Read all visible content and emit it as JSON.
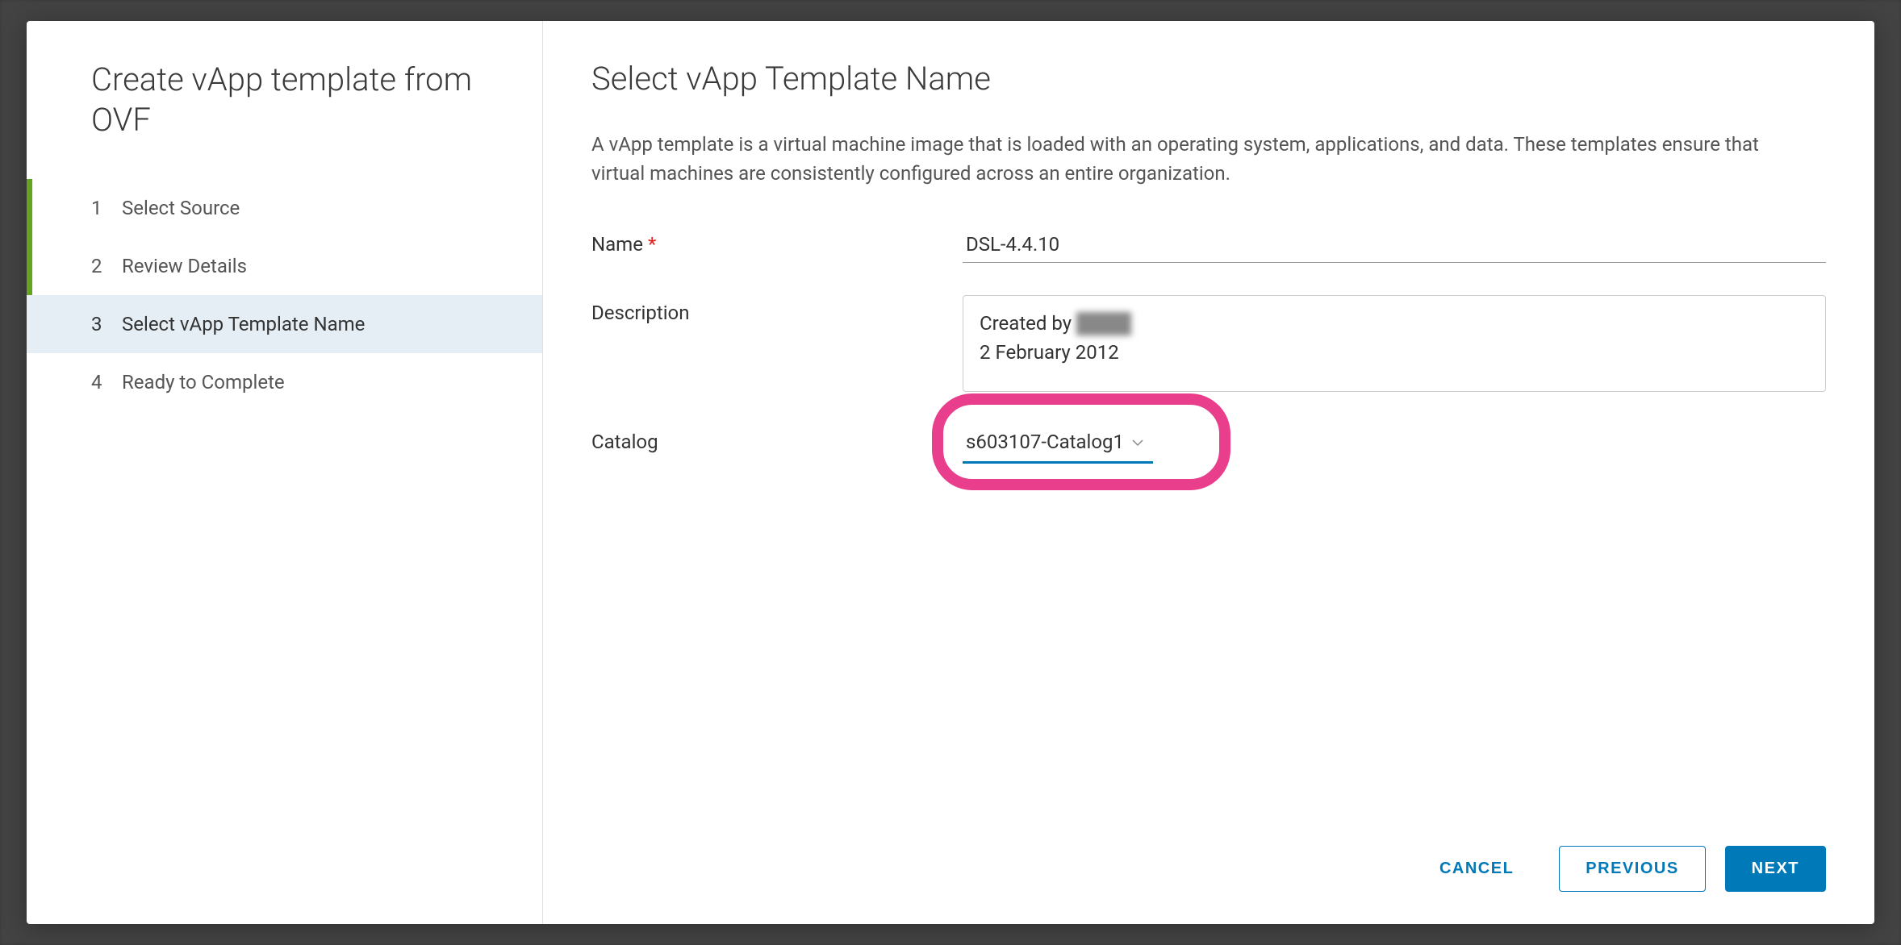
{
  "wizard": {
    "title": "Create vApp template from OVF",
    "steps": [
      {
        "num": "1",
        "label": "Select Source"
      },
      {
        "num": "2",
        "label": "Review Details"
      },
      {
        "num": "3",
        "label": "Select vApp Template Name"
      },
      {
        "num": "4",
        "label": "Ready to Complete"
      }
    ]
  },
  "main": {
    "title": "Select vApp Template Name",
    "description": "A vApp template is a virtual machine image that is loaded with an operating system, applications, and data. These templates ensure that virtual machines are consistently configured across an entire organization.",
    "labels": {
      "name": "Name",
      "description": "Description",
      "catalog": "Catalog"
    },
    "fields": {
      "name_value": "DSL-4.4.10",
      "description_line1_prefix": "Created by ",
      "description_line1_blurred": "████",
      "description_line2": "2 February 2012",
      "catalog_value": "s603107-Catalog1"
    }
  },
  "footer": {
    "cancel": "Cancel",
    "previous": "Previous",
    "next": "Next"
  }
}
